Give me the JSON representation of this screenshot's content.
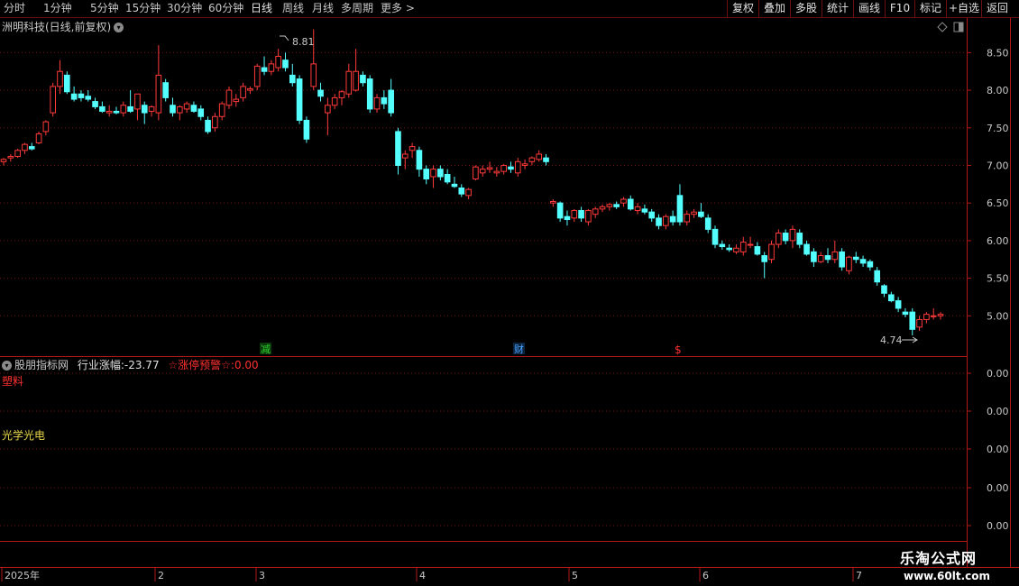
{
  "toolbar": {
    "timeframes": [
      "分时",
      "1分钟",
      "5分钟",
      "15分钟",
      "30分钟",
      "60分钟",
      "日线",
      "周线",
      "月线",
      "多周期",
      "更多"
    ],
    "right_buttons": [
      "复权",
      "叠加",
      "多股",
      "统计",
      "画线",
      "F10",
      "标记",
      "+自选",
      "返回"
    ]
  },
  "chart": {
    "title": "洲明科技(日线,前复权)",
    "high_label": "8.81",
    "low_label": "4.74",
    "y_ticks": [
      "8.50",
      "8.00",
      "7.50",
      "7.00",
      "6.50",
      "6.00",
      "5.50",
      "5.00"
    ],
    "event_markers": [
      {
        "label": "减",
        "color": "#2ed12e"
      },
      {
        "label": "财",
        "color": "#4aa3ff"
      },
      {
        "label": "$",
        "color": "#ff3030"
      }
    ],
    "up_color": "#ff3a3a",
    "down_color": "#54ffff"
  },
  "indicator": {
    "name": "股朋指标网",
    "label1": "行业涨幅:",
    "value1": "-23.77",
    "label2": "☆涨停预警☆:",
    "value2": "0.00",
    "sector1": "塑料",
    "sector2": "光学光电",
    "y_ticks": [
      "0.00",
      "0.00",
      "0.00",
      "0.00",
      "0.00"
    ]
  },
  "x_axis": {
    "labels": [
      "2025年",
      "2",
      "3",
      "4",
      "5",
      "6",
      "7"
    ]
  },
  "watermark": {
    "line1": "乐淘公式网",
    "line2": "www.60lt.com"
  },
  "chart_data": {
    "type": "candlestick",
    "ylim": [
      4.5,
      8.9
    ],
    "candles": [
      [
        7.05,
        7.1,
        7.0,
        7.08
      ],
      [
        7.1,
        7.15,
        7.05,
        7.12
      ],
      [
        7.12,
        7.22,
        7.1,
        7.2
      ],
      [
        7.2,
        7.3,
        7.15,
        7.28
      ],
      [
        7.25,
        7.3,
        7.2,
        7.22
      ],
      [
        7.3,
        7.45,
        7.28,
        7.42
      ],
      [
        7.45,
        7.6,
        7.4,
        7.58
      ],
      [
        7.7,
        8.1,
        7.65,
        8.05
      ],
      [
        8.05,
        8.4,
        7.95,
        8.25
      ],
      [
        8.2,
        8.25,
        7.95,
        7.98
      ],
      [
        7.95,
        8.05,
        7.85,
        7.88
      ],
      [
        7.95,
        8.0,
        7.85,
        7.9
      ],
      [
        7.92,
        8.0,
        7.85,
        7.88
      ],
      [
        7.85,
        7.9,
        7.75,
        7.78
      ],
      [
        7.78,
        7.85,
        7.7,
        7.72
      ],
      [
        7.7,
        7.8,
        7.65,
        7.72
      ],
      [
        7.72,
        7.78,
        7.68,
        7.7
      ],
      [
        7.7,
        7.85,
        7.65,
        7.8
      ],
      [
        7.78,
        8.0,
        7.7,
        7.72
      ],
      [
        7.75,
        7.95,
        7.6,
        7.95
      ],
      [
        7.8,
        7.85,
        7.55,
        7.7
      ],
      [
        7.72,
        7.8,
        7.65,
        7.78
      ],
      [
        7.7,
        8.6,
        7.6,
        8.2
      ],
      [
        8.1,
        8.15,
        7.85,
        7.9
      ],
      [
        7.8,
        7.9,
        7.65,
        7.7
      ],
      [
        7.7,
        7.8,
        7.6,
        7.78
      ],
      [
        7.75,
        7.85,
        7.7,
        7.82
      ],
      [
        7.8,
        7.85,
        7.7,
        7.72
      ],
      [
        7.75,
        7.8,
        7.6,
        7.65
      ],
      [
        7.6,
        7.65,
        7.42,
        7.45
      ],
      [
        7.5,
        7.7,
        7.45,
        7.65
      ],
      [
        7.65,
        7.85,
        7.6,
        7.82
      ],
      [
        7.8,
        8.05,
        7.75,
        8.0
      ],
      [
        7.85,
        7.95,
        7.78,
        7.88
      ],
      [
        7.9,
        8.1,
        7.85,
        8.05
      ],
      [
        8.0,
        8.05,
        7.95,
        8.02
      ],
      [
        8.05,
        8.35,
        8.0,
        8.32
      ],
      [
        8.3,
        8.45,
        8.2,
        8.25
      ],
      [
        8.25,
        8.4,
        8.2,
        8.35
      ],
      [
        8.3,
        8.55,
        8.25,
        8.45
      ],
      [
        8.4,
        8.5,
        8.25,
        8.3
      ],
      [
        8.2,
        8.35,
        8.05,
        8.1
      ],
      [
        8.15,
        8.2,
        7.55,
        7.6
      ],
      [
        7.6,
        7.65,
        7.3,
        7.35
      ],
      [
        8.05,
        8.81,
        8.0,
        8.35
      ],
      [
        8.0,
        8.1,
        7.85,
        7.92
      ],
      [
        7.7,
        7.9,
        7.4,
        7.8
      ],
      [
        7.8,
        7.95,
        7.75,
        7.9
      ],
      [
        7.9,
        8.0,
        7.8,
        7.98
      ],
      [
        7.95,
        8.35,
        7.9,
        8.25
      ],
      [
        8.0,
        8.55,
        7.98,
        8.25
      ],
      [
        8.2,
        8.25,
        8.05,
        8.1
      ],
      [
        8.15,
        8.2,
        7.7,
        7.75
      ],
      [
        7.75,
        7.95,
        7.7,
        7.9
      ],
      [
        7.9,
        8.0,
        7.75,
        7.82
      ],
      [
        8.0,
        8.15,
        7.65,
        7.7
      ],
      [
        7.45,
        7.5,
        6.88,
        7.0
      ],
      [
        7.1,
        7.2,
        6.95,
        7.15
      ],
      [
        7.2,
        7.3,
        7.1,
        7.25
      ],
      [
        7.2,
        7.25,
        6.85,
        6.95
      ],
      [
        6.95,
        7.0,
        6.75,
        6.82
      ],
      [
        6.85,
        7.0,
        6.7,
        6.95
      ],
      [
        6.95,
        7.0,
        6.8,
        6.85
      ],
      [
        6.88,
        6.95,
        6.75,
        6.78
      ],
      [
        6.75,
        6.85,
        6.7,
        6.72
      ],
      [
        6.7,
        6.75,
        6.58,
        6.62
      ],
      [
        6.6,
        6.7,
        6.55,
        6.68
      ],
      [
        6.82,
        7.0,
        6.8,
        6.98
      ],
      [
        6.9,
        7.0,
        6.85,
        6.95
      ],
      [
        6.95,
        7.05,
        6.9,
        6.97
      ],
      [
        6.9,
        6.98,
        6.85,
        6.92
      ],
      [
        6.92,
        7.02,
        6.88,
        7.0
      ],
      [
        6.98,
        7.05,
        6.9,
        6.95
      ],
      [
        6.9,
        7.1,
        6.85,
        7.05
      ],
      [
        7.0,
        7.08,
        6.95,
        7.02
      ],
      [
        7.05,
        7.12,
        7.0,
        7.1
      ],
      [
        7.08,
        7.2,
        7.05,
        7.15
      ],
      [
        7.1,
        7.15,
        7.0,
        7.05
      ],
      [
        6.5,
        6.55,
        6.45,
        6.52
      ],
      [
        6.5,
        6.52,
        6.25,
        6.3
      ],
      [
        6.32,
        6.4,
        6.2,
        6.28
      ],
      [
        6.3,
        6.42,
        6.25,
        6.4
      ],
      [
        6.4,
        6.45,
        6.25,
        6.3
      ],
      [
        6.25,
        6.42,
        6.2,
        6.4
      ],
      [
        6.35,
        6.45,
        6.3,
        6.42
      ],
      [
        6.42,
        6.48,
        6.38,
        6.45
      ],
      [
        6.45,
        6.5,
        6.4,
        6.48
      ],
      [
        6.48,
        6.52,
        6.42,
        6.45
      ],
      [
        6.5,
        6.58,
        6.45,
        6.55
      ],
      [
        6.55,
        6.6,
        6.4,
        6.42
      ],
      [
        6.4,
        6.5,
        6.35,
        6.45
      ],
      [
        6.42,
        6.48,
        6.35,
        6.38
      ],
      [
        6.38,
        6.42,
        6.25,
        6.3
      ],
      [
        6.3,
        6.35,
        6.15,
        6.2
      ],
      [
        6.2,
        6.35,
        6.15,
        6.32
      ],
      [
        6.32,
        6.4,
        6.2,
        6.25
      ],
      [
        6.6,
        6.75,
        6.2,
        6.25
      ],
      [
        6.25,
        6.4,
        6.2,
        6.35
      ],
      [
        6.35,
        6.42,
        6.3,
        6.38
      ],
      [
        6.38,
        6.5,
        6.3,
        6.32
      ],
      [
        6.3,
        6.35,
        6.1,
        6.15
      ],
      [
        6.15,
        6.2,
        5.9,
        5.95
      ],
      [
        5.95,
        6.0,
        5.88,
        5.92
      ],
      [
        5.9,
        5.95,
        5.85,
        5.88
      ],
      [
        5.85,
        5.95,
        5.82,
        5.9
      ],
      [
        5.85,
        6.05,
        5.8,
        5.98
      ],
      [
        5.95,
        6.05,
        5.9,
        5.95
      ],
      [
        5.92,
        5.98,
        5.8,
        5.82
      ],
      [
        5.8,
        5.85,
        5.5,
        5.72
      ],
      [
        5.75,
        6.0,
        5.7,
        5.95
      ],
      [
        5.95,
        6.15,
        5.9,
        6.1
      ],
      [
        6.1,
        6.15,
        5.95,
        6.0
      ],
      [
        6.0,
        6.2,
        5.9,
        6.15
      ],
      [
        6.1,
        6.15,
        5.9,
        5.95
      ],
      [
        5.95,
        6.0,
        5.8,
        5.82
      ],
      [
        5.85,
        5.9,
        5.65,
        5.72
      ],
      [
        5.72,
        5.85,
        5.7,
        5.8
      ],
      [
        5.8,
        5.9,
        5.7,
        5.75
      ],
      [
        5.75,
        6.0,
        5.7,
        5.85
      ],
      [
        5.85,
        5.9,
        5.6,
        5.65
      ],
      [
        5.6,
        5.8,
        5.55,
        5.78
      ],
      [
        5.78,
        5.85,
        5.7,
        5.75
      ],
      [
        5.75,
        5.8,
        5.65,
        5.7
      ],
      [
        5.72,
        5.75,
        5.6,
        5.65
      ],
      [
        5.6,
        5.65,
        5.4,
        5.45
      ],
      [
        5.4,
        5.42,
        5.25,
        5.3
      ],
      [
        5.28,
        5.32,
        5.18,
        5.2
      ],
      [
        5.2,
        5.25,
        5.05,
        5.1
      ],
      [
        5.05,
        5.1,
        4.98,
        5.02
      ],
      [
        5.05,
        5.1,
        4.74,
        4.82
      ],
      [
        4.85,
        5.0,
        4.8,
        4.95
      ],
      [
        4.95,
        5.05,
        4.9,
        5.02
      ],
      [
        5.0,
        5.1,
        4.95,
        5.0
      ],
      [
        5.0,
        5.05,
        4.95,
        5.02
      ]
    ]
  }
}
